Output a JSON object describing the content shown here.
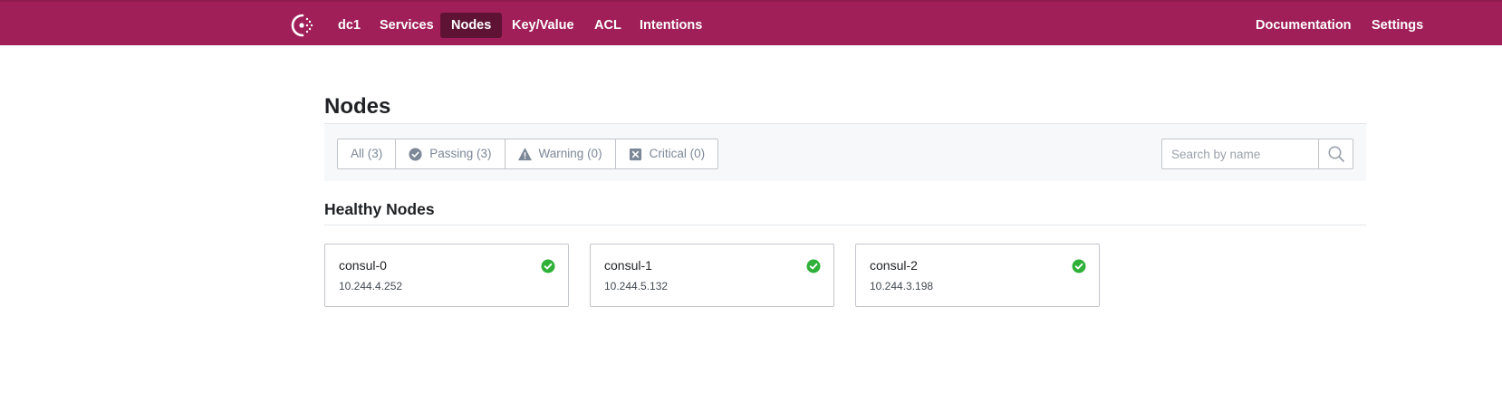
{
  "nav": {
    "logo_icon": "consul-logo-icon",
    "datacenter": "dc1",
    "items": [
      {
        "label": "Services",
        "active": false
      },
      {
        "label": "Nodes",
        "active": true
      },
      {
        "label": "Key/Value",
        "active": false
      },
      {
        "label": "ACL",
        "active": false
      },
      {
        "label": "Intentions",
        "active": false
      }
    ],
    "documentation": "Documentation",
    "settings": "Settings",
    "brand_color": "#a01f58",
    "active_color": "#5e1335"
  },
  "page": {
    "title": "Nodes"
  },
  "filters": [
    {
      "label": "All (3)",
      "icon": null
    },
    {
      "label": "Passing (3)",
      "icon": "passing-check-icon"
    },
    {
      "label": "Warning (0)",
      "icon": "warning-triangle-icon"
    },
    {
      "label": "Critical (0)",
      "icon": "critical-x-icon"
    }
  ],
  "search": {
    "placeholder": "Search by name",
    "icon": "search-icon"
  },
  "section": {
    "title": "Healthy Nodes"
  },
  "nodes": [
    {
      "name": "consul-0",
      "address": "10.244.4.252",
      "status": "passing"
    },
    {
      "name": "consul-1",
      "address": "10.244.5.132",
      "status": "passing"
    },
    {
      "name": "consul-2",
      "address": "10.244.3.198",
      "status": "passing"
    }
  ],
  "status_colors": {
    "passing": "#2eb039"
  }
}
